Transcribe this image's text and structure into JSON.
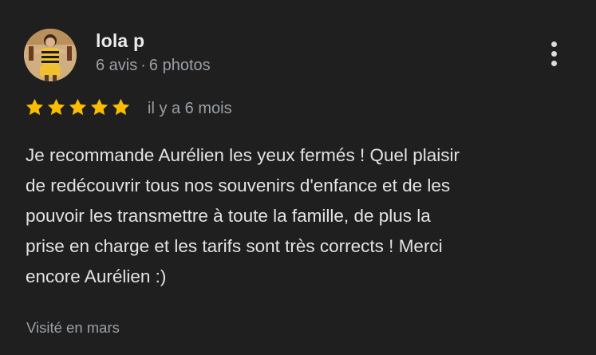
{
  "reviewer": {
    "name": "lola p",
    "reviews_count": "6 avis",
    "separator": "·",
    "photos_count": "6 photos"
  },
  "rating": {
    "stars": 5,
    "max": 5,
    "color": "#fbbc04",
    "time_ago": "il y a 6 mois"
  },
  "review": {
    "lines": [
      "Je recommande Aurélien les yeux fermés ! Quel plaisir",
      "de redécouvrir tous nos souvenirs d'enfance et de les",
      "pouvoir les transmettre à toute la famille, de plus la",
      "prise en charge et les tarifs sont très corrects ! Merci",
      "encore Aurélien :)"
    ]
  },
  "visited": "Visité en mars",
  "icons": {
    "menu": "more-vert-icon",
    "star": "star-icon"
  },
  "colors": {
    "background": "#1f1f1f",
    "text": "#e3e3e3",
    "muted": "#9aa0a6"
  }
}
